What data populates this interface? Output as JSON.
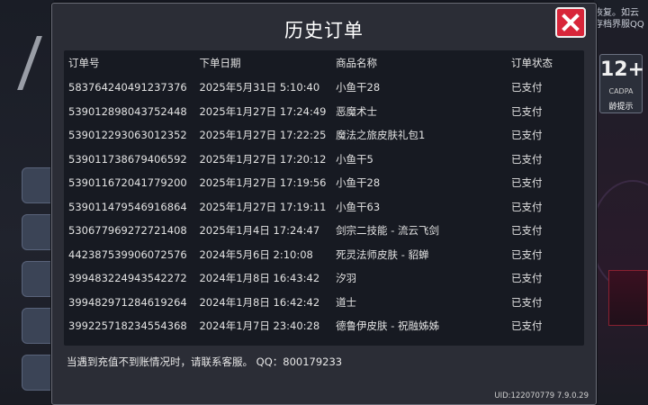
{
  "dialog": {
    "title": "历史订单",
    "close_icon": "close-icon",
    "accent_close": "#d8263a"
  },
  "table": {
    "headers": [
      "订单号",
      "下单日期",
      "商品名称",
      "订单状态"
    ],
    "rows": [
      {
        "order_id": "583764240491237376",
        "date": "2025年5月31日 5:10:40",
        "item": "小鱼干28",
        "status": "已支付"
      },
      {
        "order_id": "539012898043752448",
        "date": "2025年1月27日 17:24:49",
        "item": "恶魔术士",
        "status": "已支付"
      },
      {
        "order_id": "539012293063012352",
        "date": "2025年1月27日 17:22:25",
        "item": "魔法之旅皮肤礼包1",
        "status": "已支付"
      },
      {
        "order_id": "539011738679406592",
        "date": "2025年1月27日 17:20:12",
        "item": "小鱼干5",
        "status": "已支付"
      },
      {
        "order_id": "539011672041779200",
        "date": "2025年1月27日 17:19:56",
        "item": "小鱼干28",
        "status": "已支付"
      },
      {
        "order_id": "539011479546916864",
        "date": "2025年1月27日 17:19:11",
        "item": "小鱼干63",
        "status": "已支付"
      },
      {
        "order_id": "530677969272721408",
        "date": "2025年1月4日 17:24:47",
        "item": "剑宗二技能 - 流云飞剑",
        "status": "已支付"
      },
      {
        "order_id": "442387539906072576",
        "date": "2024年5月6日 2:10:08",
        "item": "死灵法师皮肤 - 貂蝉",
        "status": "已支付"
      },
      {
        "order_id": "399483224943542272",
        "date": "2024年1月8日 16:43:42",
        "item": "汐羽",
        "status": "已支付"
      },
      {
        "order_id": "399482971284619264",
        "date": "2024年1月8日 16:42:42",
        "item": "道士",
        "status": "已支付"
      },
      {
        "order_id": "399225718234554368",
        "date": "2024年1月7日 23:40:28",
        "item": "德鲁伊皮肤 - 祝融姊姊",
        "status": "已支付"
      }
    ]
  },
  "footer": {
    "note": "当遇到充值不到账情况时，请联系客服。 QQ：800179233",
    "uid": "UID:122070779 7.9.0.29"
  },
  "background": {
    "notice": "恢复。如云存档界服QQ",
    "age_badge_num": "12+",
    "age_badge_sub": "CADPA",
    "age_badge_tip": "龄提示"
  }
}
